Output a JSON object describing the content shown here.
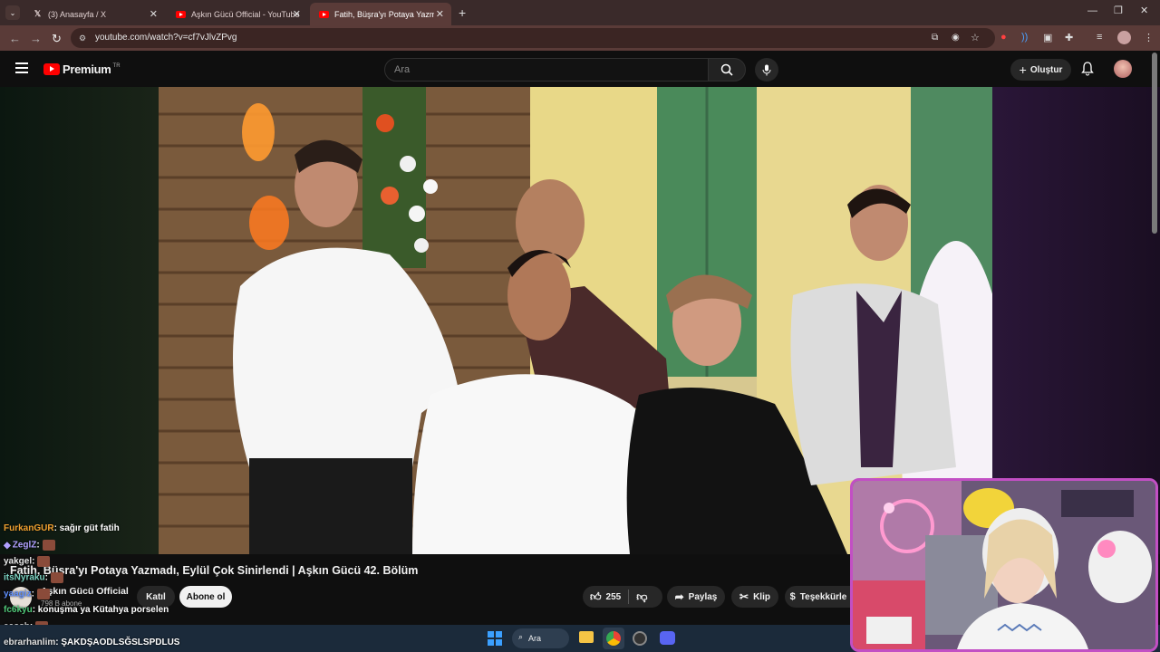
{
  "browser": {
    "tabs": [
      {
        "label": "(3) Anasayfa / X",
        "icon": "x-logo-icon"
      },
      {
        "label": "Aşkın Gücü Official - YouTube",
        "icon": "youtube-icon"
      },
      {
        "label": "Fatih, Büşra'yı Potaya Yazmadı,",
        "icon": "youtube-icon",
        "active": true
      }
    ],
    "new_tab_label": "+",
    "url": "youtube.com/watch?v=cf7vJlvZPvg"
  },
  "youtube": {
    "logo_text": "Premium",
    "region": "TR",
    "search_placeholder": "Ara",
    "create_label": "Oluştur"
  },
  "video": {
    "title": "Fatih, Büşra'yı Potaya Yazmadı, Eylül Çok Sinirlendi | Aşkın Gücü 42. Bölüm",
    "channel_name": "Aşkın Gücü Official",
    "subscribers": "798 B abone",
    "join_label": "Katıl",
    "subscribe_label": "Abone ol",
    "likes": "255",
    "share_label": "Paylaş",
    "clip_label": "Klip",
    "thanks_label": "Teşekkürle"
  },
  "chat": [
    {
      "user": "FurkanGUR",
      "text": ": sağır güt fatih",
      "color": "#f0a030"
    },
    {
      "user": "ZeglZ",
      "text": ":",
      "color": "#b0a0ff",
      "emote": true
    },
    {
      "user": "yakgel",
      "text": ":",
      "color": "#e8e8e8",
      "emote": true
    },
    {
      "user": "itsNyraku",
      "text": ":",
      "color": "#7ad0c0",
      "emote": true
    },
    {
      "user": "yaagiz",
      "text": ":",
      "color": "#6090ff",
      "emote": true
    },
    {
      "user": "fc6kyu",
      "text": ": konuşma ya Kütahya porselen",
      "color": "#50c878"
    },
    {
      "user": "ecosh",
      "text": ":",
      "color": "#c0c0c0",
      "emote": true
    },
    {
      "user": "ebrarhanlim",
      "text": ": ŞAKDŞAODLSĞSLSPDLUS",
      "color": "#e0e0e0"
    }
  ],
  "taskbar": {
    "search_label": "Ara"
  },
  "colors": {
    "tab_bar": "#3a2a2a",
    "address_bar": "#5a3b38",
    "youtube_red": "#ff0000",
    "subscribe_bg": "#f1f1f1",
    "webcam_border": "#c24fc4"
  }
}
